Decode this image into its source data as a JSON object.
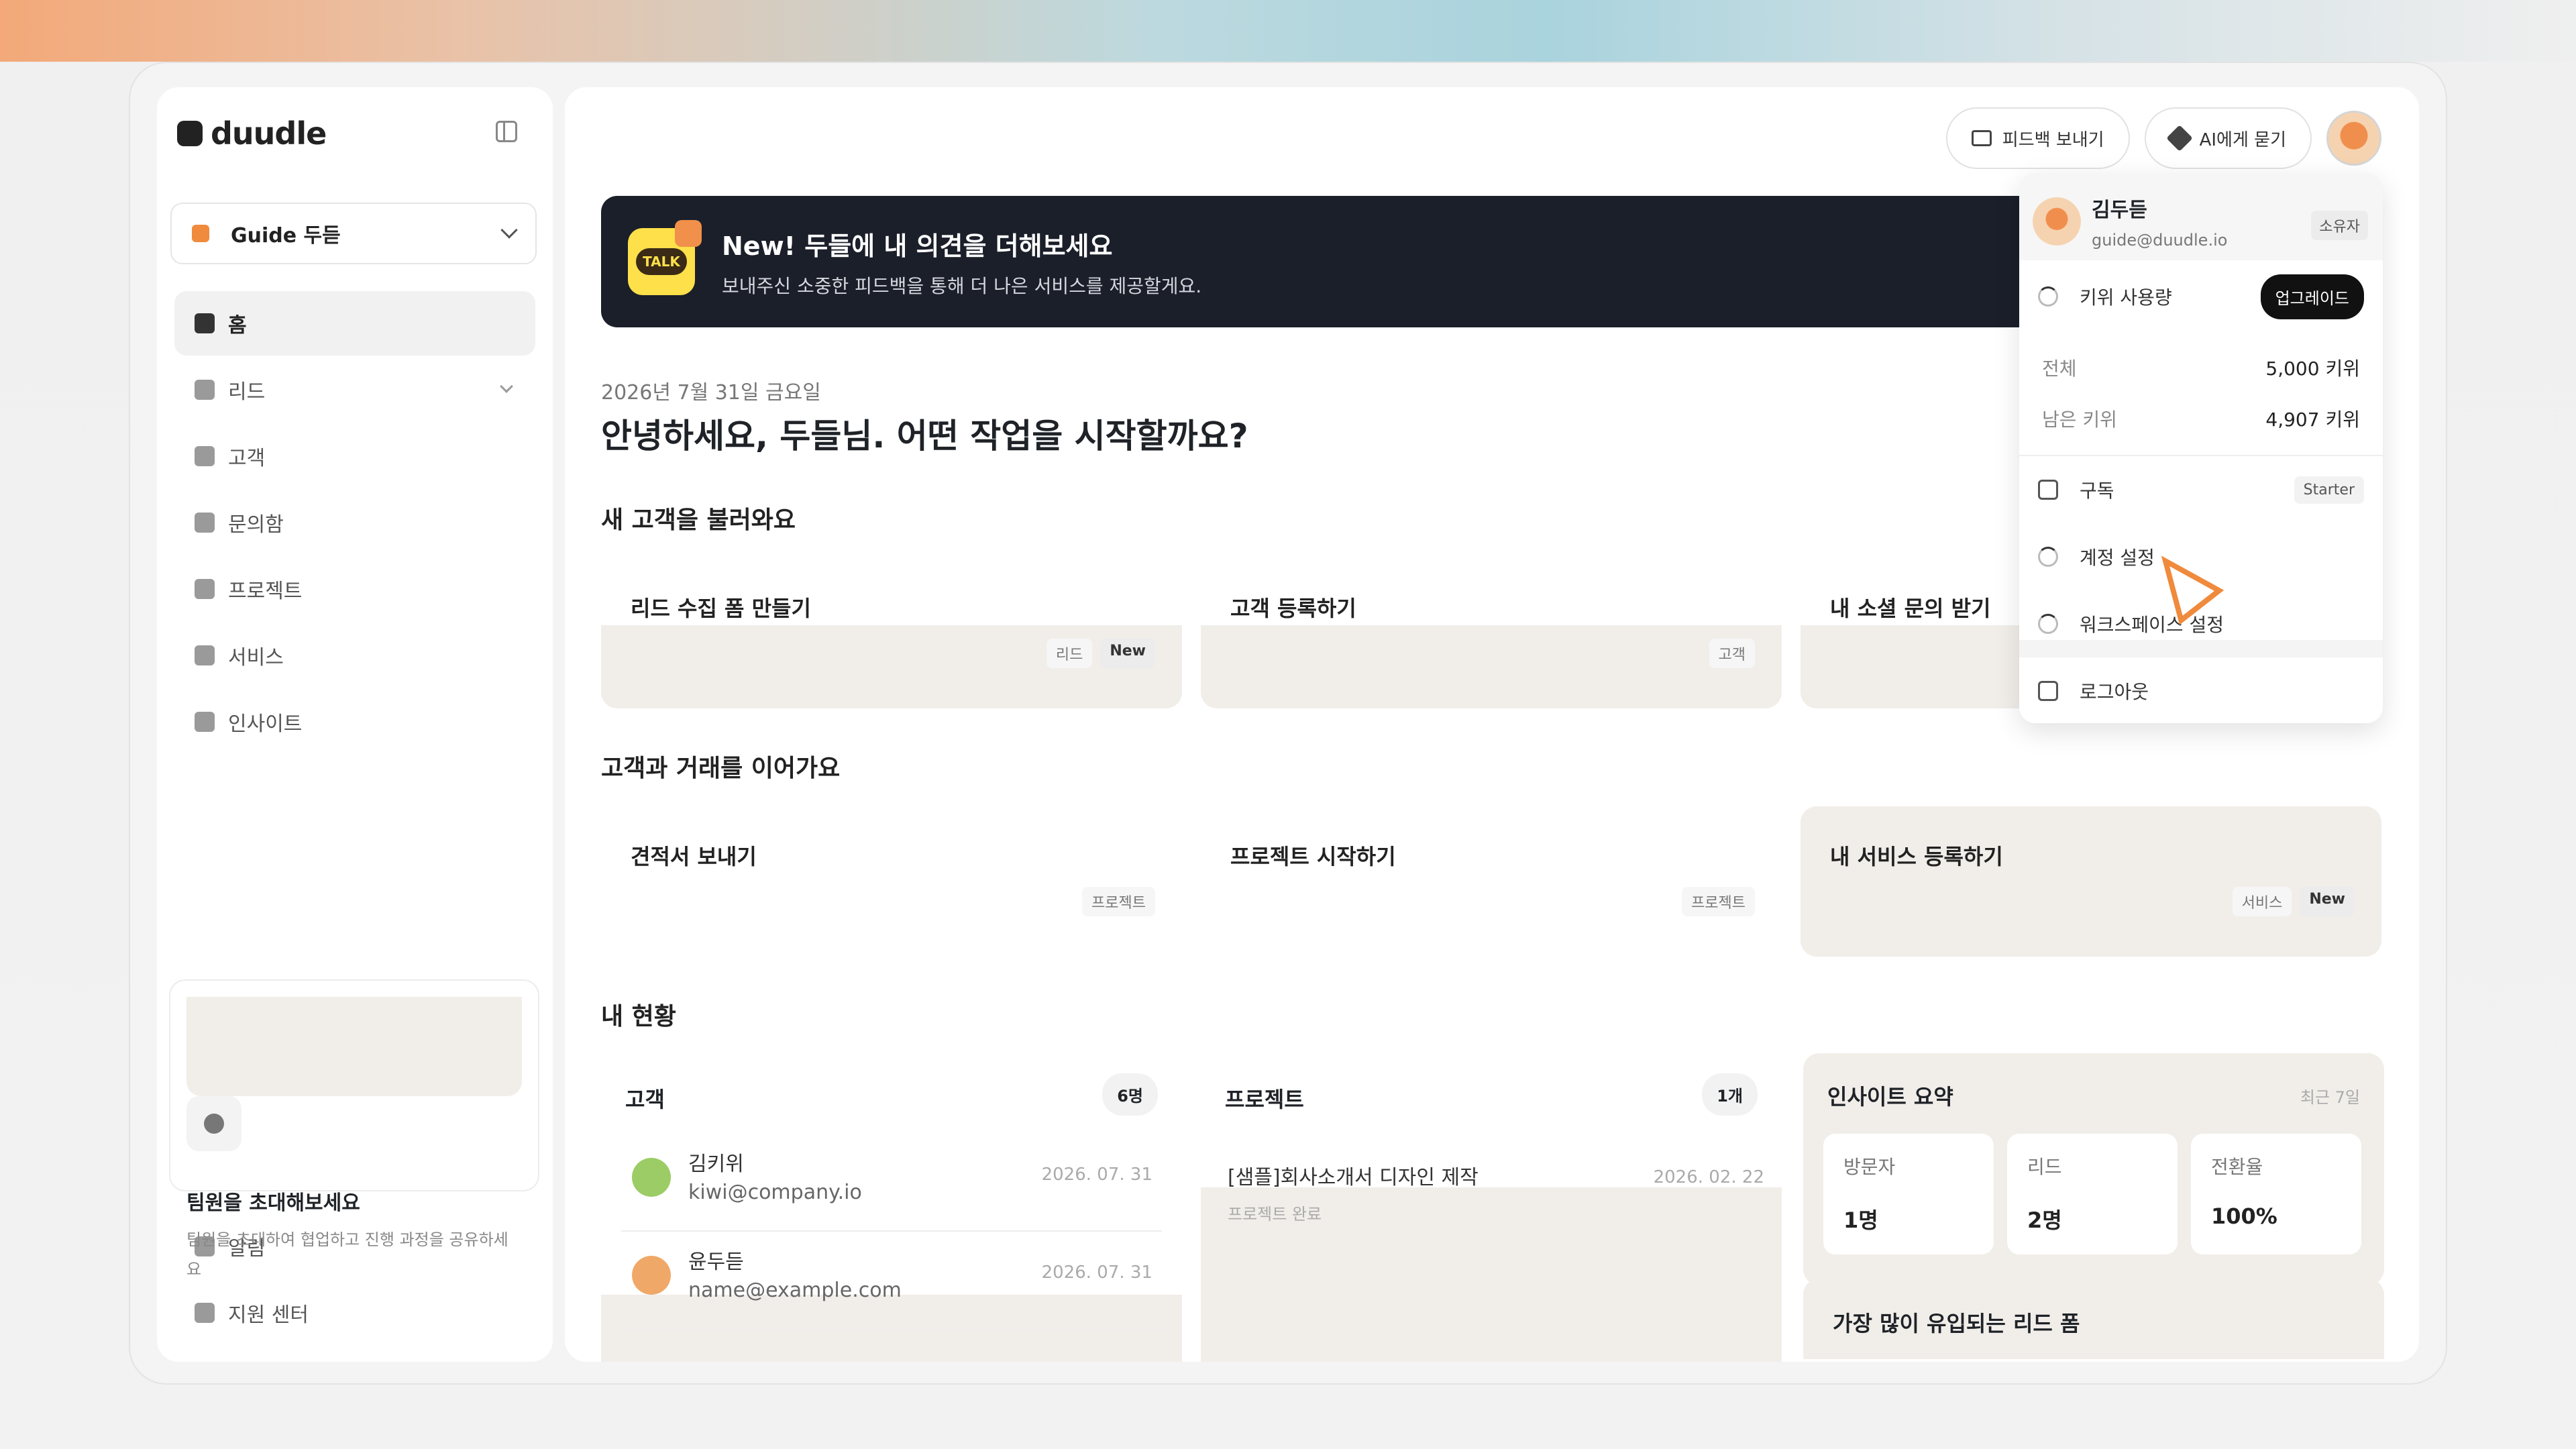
{
  "brand": {
    "name": "duudle"
  },
  "workspace": {
    "label": "Guide 두듣"
  },
  "nav": {
    "items": [
      {
        "label": "홈",
        "icon": "home-icon"
      },
      {
        "label": "리드",
        "icon": "tag-icon"
      },
      {
        "label": "고객",
        "icon": "user-icon"
      },
      {
        "label": "문의함",
        "icon": "inbox-icon"
      },
      {
        "label": "프로젝트",
        "icon": "folder-icon"
      },
      {
        "label": "서비스",
        "icon": "briefcase-icon"
      },
      {
        "label": "인사이트",
        "icon": "bar-chart-icon"
      }
    ],
    "bottom": [
      {
        "label": "알림",
        "icon": "bell-icon"
      },
      {
        "label": "지원 센터",
        "icon": "help-icon"
      }
    ]
  },
  "invite": {
    "title": "팀원을 초대해보세요",
    "desc": "팀원을 초대하여 협업하고 진행 과정을 공유하세요"
  },
  "header": {
    "feedback_label": "피드백 보내기",
    "ai_label": "AI에게 묻기"
  },
  "banner": {
    "title": "New! 두들에 내 의견을 더해보세요",
    "subtitle": "보내주신 소중한 피드백을 통해 더 나은 서비스를 제공할게요.",
    "icon_text": "TALK"
  },
  "main": {
    "date": "2026년 7월 31일 금요일",
    "greeting": "안녕하세요, 두들님. 어떤 작업을 시작할까요?",
    "section_new": "새 고객을 불러와요",
    "section_continue": "고객과 거래를 이어가요",
    "section_status": "내 현황"
  },
  "tasks": {
    "new": [
      {
        "title": "리드 수집 폼 만들기",
        "tag": "리드",
        "badge": "New"
      },
      {
        "title": "고객 등록하기",
        "tag": "고객"
      },
      {
        "title": "내 소셜 문의 받기"
      }
    ],
    "continue": [
      {
        "title": "견적서 보내기",
        "tag": "프로젝트"
      },
      {
        "title": "프로젝트 시작하기",
        "tag": "프로젝트"
      },
      {
        "title": "내 서비스 등록하기",
        "tag": "서비스",
        "badge": "New"
      }
    ]
  },
  "customers": {
    "title": "고객",
    "count": "6명",
    "rows": [
      {
        "name": "김키위",
        "email": "kiwi@company.io",
        "date": "2026. 07. 31"
      },
      {
        "name": "윤두듣",
        "email": "name@example.com",
        "date": "2026. 07. 31"
      }
    ]
  },
  "projects": {
    "title": "프로젝트",
    "count": "1개",
    "rows": [
      {
        "name": "[샘플]회사소개서 디자인 제작",
        "status": "프로젝트 완료",
        "date": "2026. 02. 22"
      }
    ]
  },
  "insight": {
    "title": "인사이트 요약",
    "period": "최근 7일",
    "metrics": [
      {
        "label": "방문자",
        "value": "1명"
      },
      {
        "label": "리드",
        "value": "2명"
      },
      {
        "label": "전환율",
        "value": "100%"
      }
    ]
  },
  "lead_card": {
    "title": "가장 많이 유입되는 리드 폼"
  },
  "dropdown": {
    "name": "김두듣",
    "email": "guide@duudle.io",
    "role": "소유자",
    "usage_label": "키위 사용량",
    "upgrade_label": "업그레이드",
    "total_key": "전체",
    "total_value": "5,000 키위",
    "remaining_key": "남은 키위",
    "remaining_value": "4,907 키위",
    "subscription_label": "구독",
    "plan": "Starter",
    "account_label": "계정 설정",
    "workspace_label": "워크스페이스 설정",
    "logout_label": "로그아웃"
  },
  "colors": {
    "accent": "#f08a3c",
    "banner_bg": "#1b1f2a",
    "talk_yellow": "#fde04a"
  }
}
